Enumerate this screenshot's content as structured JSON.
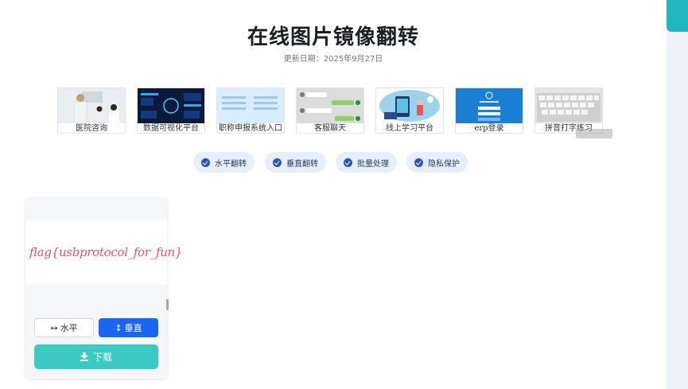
{
  "header": {
    "title": "在线图片镜像翻转",
    "updated": "更新日期：2025年9月27日"
  },
  "thumbnails": [
    {
      "caption": "医院咨询",
      "icon": "hospital-consult-photo"
    },
    {
      "caption": "数据可视化平台",
      "icon": "dashboard-photo"
    },
    {
      "caption": "职称申报系统入口",
      "icon": "form-photo"
    },
    {
      "caption": "客服聊天",
      "icon": "chat-photo"
    },
    {
      "caption": "线上学习平台",
      "icon": "e-learning-photo"
    },
    {
      "caption": "erp登录",
      "icon": "erp-login-photo"
    },
    {
      "caption": "拼音打字练习",
      "icon": "keyboard-photo"
    }
  ],
  "features": [
    {
      "label": "水平翻转"
    },
    {
      "label": "垂直翻转"
    },
    {
      "label": "批量处理"
    },
    {
      "label": "隐私保护"
    }
  ],
  "card": {
    "preview_text": "flag{usbprotocol_for_fun}",
    "horizontal_label": "水平",
    "vertical_label": "垂直",
    "download_label": "下载"
  },
  "colors": {
    "accent": "#1a66f0",
    "download": "#3cc9c3",
    "pill_bg": "#e6efff",
    "check": "#2c54b8",
    "rail_tab": "#22b6c1"
  }
}
